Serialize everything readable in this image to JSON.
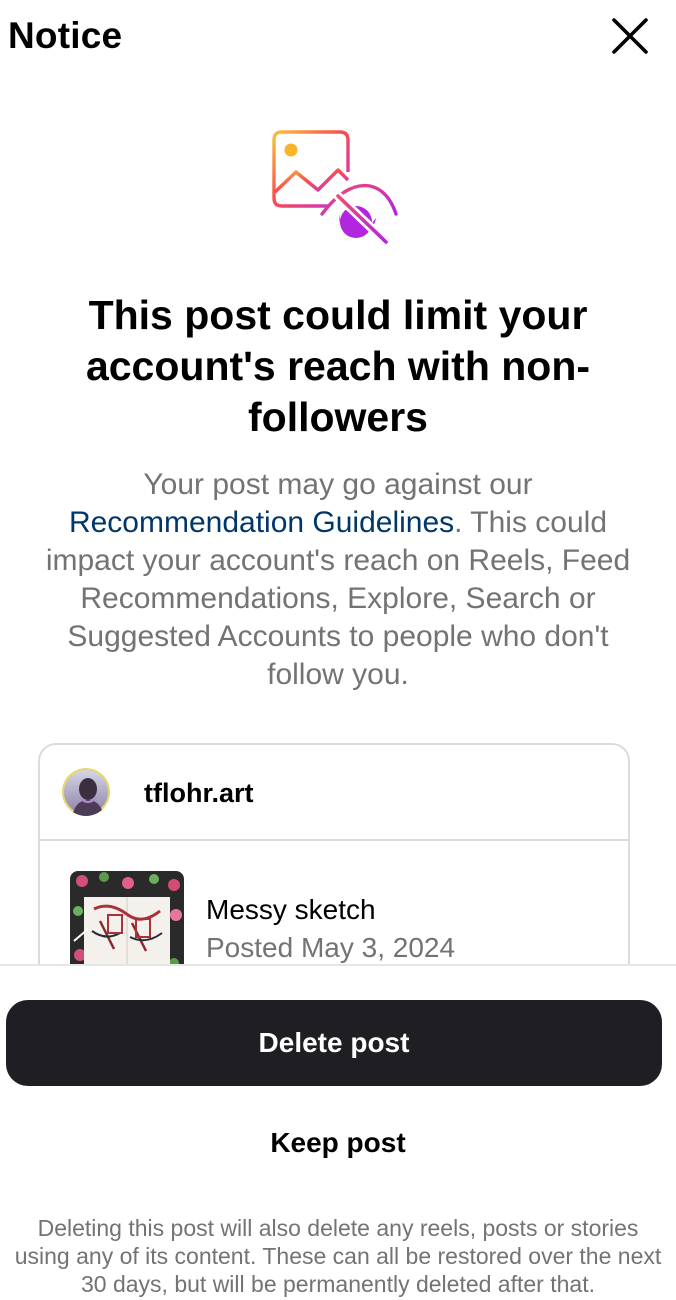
{
  "header": {
    "title": "Notice"
  },
  "notice": {
    "headline": "This post could limit your account's reach with non-followers",
    "body_prefix": "Your post may go against our",
    "body_link": "Recommendation Guidelines",
    "body_suffix": ". This could impact your account's reach on Reels, Feed Recommendations, Explore, Search or Suggested Accounts to people who don't follow you."
  },
  "post": {
    "username": "tflohr.art",
    "caption": "Messy sketch",
    "date": "Posted May 3, 2024"
  },
  "actions": {
    "delete_label": "Delete post",
    "keep_label": "Keep post"
  },
  "footer": {
    "note": "Deleting this post will also delete any reels, posts or stories using any of its content. These can all be restored over the next 30 days, but will be permanently deleted after that."
  },
  "icons": {
    "close": "close-icon",
    "hero": "hidden-image-icon"
  },
  "colors": {
    "link": "#00376b",
    "secondary_text": "#737373",
    "primary_button": "#1f1f23",
    "border": "#dbdbdb"
  }
}
